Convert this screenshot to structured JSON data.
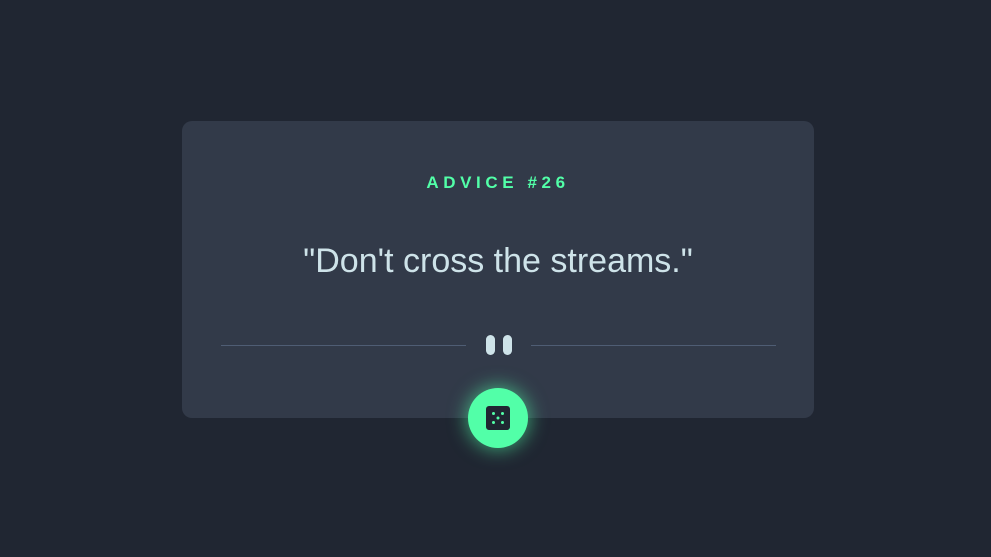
{
  "advice": {
    "id_label": "ADVICE #26",
    "quote": "\"Don't cross the streams.\""
  },
  "divider": {
    "icon": "pause-icon"
  },
  "dice_button": {
    "icon": "dice-icon"
  },
  "colors": {
    "background": "#202632",
    "card": "#323a49",
    "accent": "#52ffa8",
    "text": "#cee3e9",
    "divider": "#4f5d74"
  }
}
